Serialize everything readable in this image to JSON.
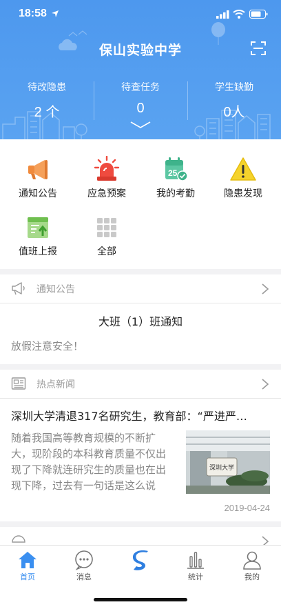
{
  "status": {
    "time": "18:58"
  },
  "header": {
    "title": "保山实验中学",
    "stats": [
      {
        "label": "待改隐患",
        "value": "2 个"
      },
      {
        "label": "待查任务",
        "value": "0"
      },
      {
        "label": "学生缺勤",
        "value": "0人"
      }
    ]
  },
  "quick": {
    "items": [
      {
        "label": "通知公告",
        "icon": "megaphone-icon"
      },
      {
        "label": "应急预案",
        "icon": "alarm-light-icon"
      },
      {
        "label": "我的考勤",
        "icon": "calendar-check-icon"
      },
      {
        "label": "隐患发现",
        "icon": "warning-icon"
      },
      {
        "label": "值班上报",
        "icon": "duty-report-icon"
      },
      {
        "label": "全部",
        "icon": "grid-icon"
      }
    ]
  },
  "notice": {
    "header": "通知公告",
    "title": "大班（1）班通知",
    "body": "放假注意安全！"
  },
  "news": {
    "header": "热点新闻",
    "title": "深圳大学清退317名研究生，教育部：“严进严…",
    "summary": "随着我国高等教育规模的不断扩大，现阶段的本科教育质量不仅出现了下降就连研究生的质量也在出现下降，过去有一句话是这么说",
    "date": "2019-04-24",
    "image_sign_text": "深圳大学"
  },
  "tabs": [
    {
      "label": "首页",
      "icon": "home-icon",
      "active": true
    },
    {
      "label": "消息",
      "icon": "chat-icon"
    },
    {
      "label": "",
      "icon": "logo-s-icon"
    },
    {
      "label": "统计",
      "icon": "bar-chart-icon"
    },
    {
      "label": "我的",
      "icon": "user-icon"
    }
  ],
  "colors": {
    "header_blue": "#4d98ee",
    "accent": "#3a8ff0",
    "alert_red": "#ef4b3f",
    "warning_yellow": "#f5d32c",
    "calendar_green": "#5cc7a3",
    "megaphone_orange": "#f08a3c"
  }
}
